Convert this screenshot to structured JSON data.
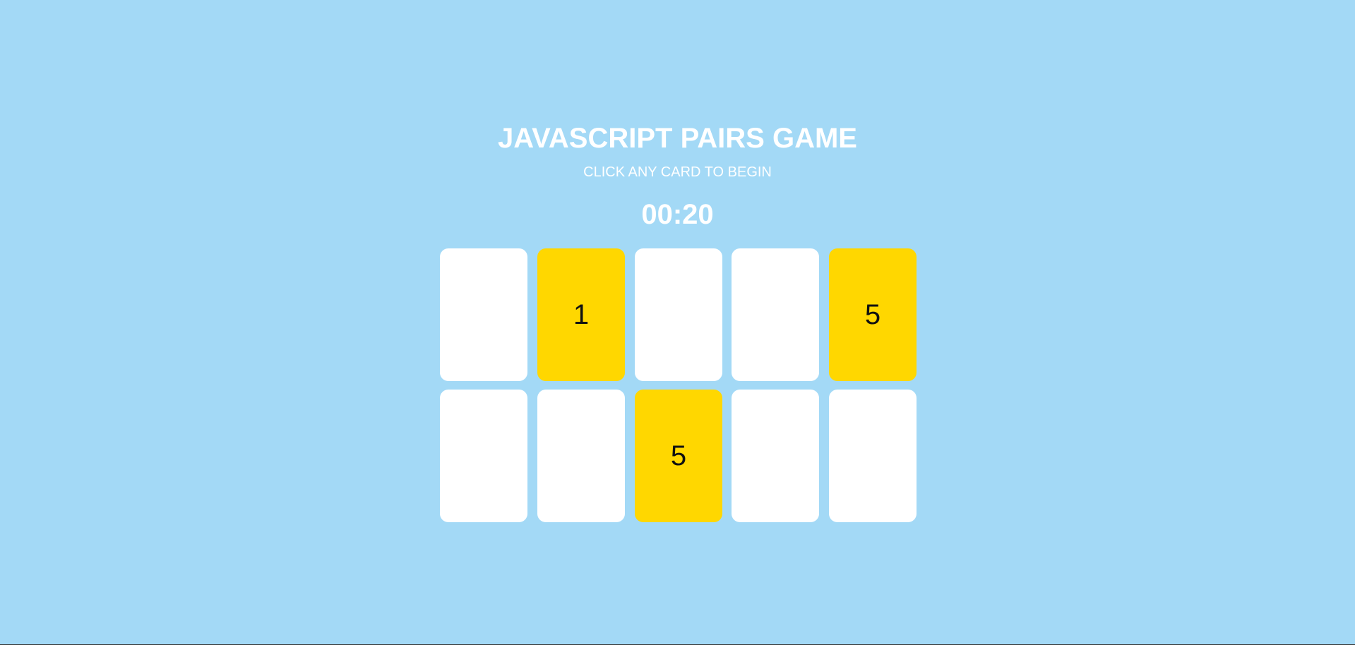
{
  "game": {
    "title": "JAVASCRIPT PAIRS GAME",
    "subtitle": "CLICK ANY CARD TO BEGIN",
    "timer": "00:20"
  },
  "colors": {
    "background": "#a3d9f6",
    "card_hidden": "#ffffff",
    "card_revealed": "#ffd700",
    "header_text": "#ffffff"
  },
  "board": {
    "rows": 2,
    "columns": 5,
    "cards": [
      {
        "state": "hidden",
        "value": ""
      },
      {
        "state": "revealed",
        "value": "1"
      },
      {
        "state": "hidden",
        "value": ""
      },
      {
        "state": "hidden",
        "value": ""
      },
      {
        "state": "revealed",
        "value": "5"
      },
      {
        "state": "hidden",
        "value": ""
      },
      {
        "state": "hidden",
        "value": ""
      },
      {
        "state": "revealed",
        "value": "5"
      },
      {
        "state": "hidden",
        "value": ""
      },
      {
        "state": "hidden",
        "value": ""
      }
    ]
  }
}
